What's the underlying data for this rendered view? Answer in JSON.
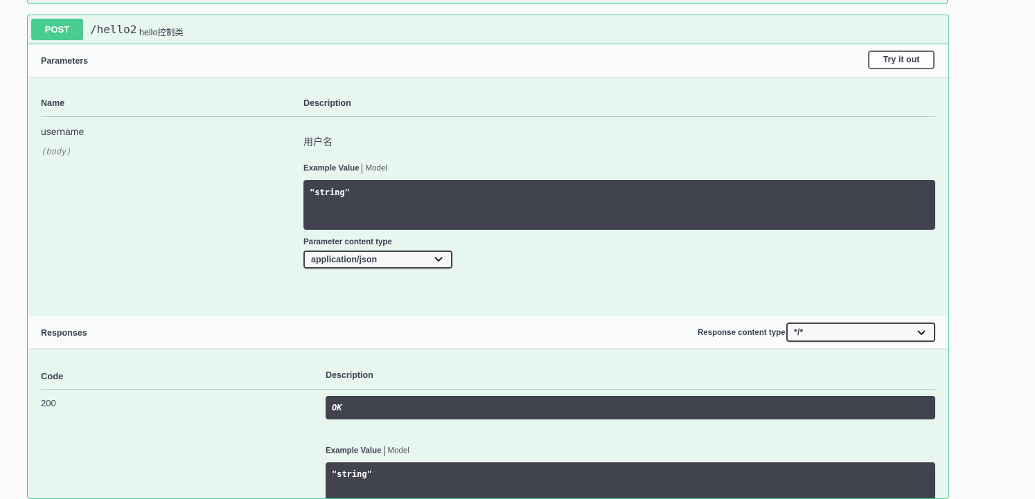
{
  "operation": {
    "method": "POST",
    "path": "/hello2",
    "description": "hello控制类"
  },
  "parameters": {
    "title": "Parameters",
    "try_button": "Try it out",
    "col_name": "Name",
    "col_description": "Description",
    "items": [
      {
        "name": "username",
        "in": "(body)",
        "description": "用户名",
        "example_tab": "Example Value",
        "model_tab": "Model",
        "example": "\"string\"",
        "content_type_label": "Parameter content type",
        "content_type": "application/json"
      }
    ]
  },
  "responses": {
    "title": "Responses",
    "content_type_label": "Response content type",
    "content_type": "*/*",
    "col_code": "Code",
    "col_description": "Description",
    "items": [
      {
        "code": "200",
        "description": "OK",
        "example_tab": "Example Value",
        "model_tab": "Model",
        "example": "\"string\""
      }
    ]
  },
  "icons": {
    "select_arrow": "chevron-down-icon"
  },
  "colors": {
    "post_accent": "#49cc90",
    "post_background": "#e8f6f0",
    "code_background": "#41444e"
  }
}
